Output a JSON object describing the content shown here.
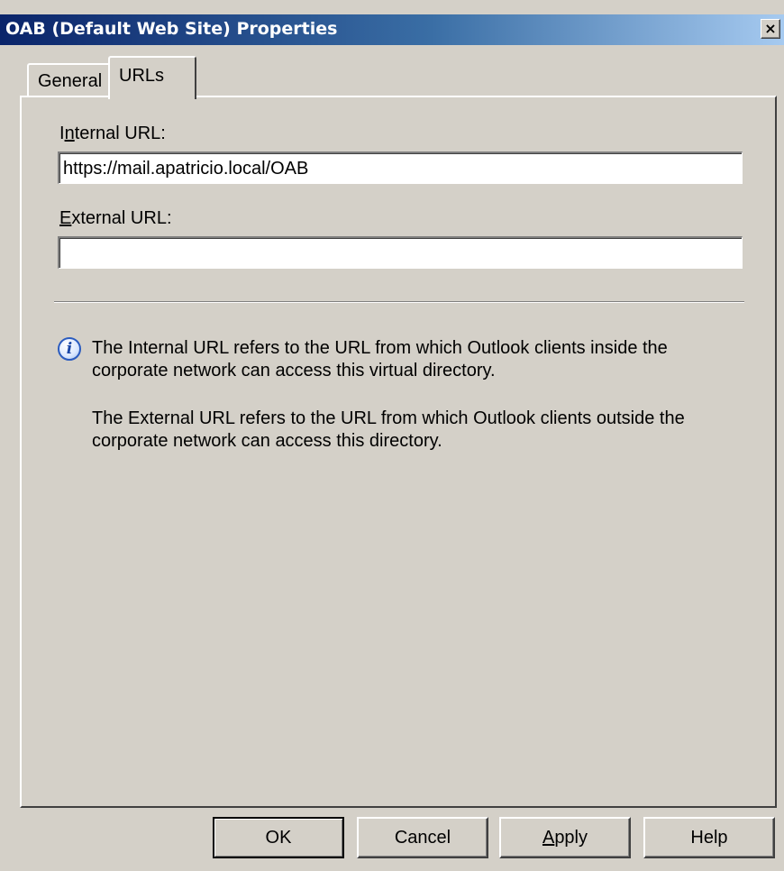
{
  "window": {
    "title": "OAB (Default Web Site) Properties",
    "close_glyph": "×",
    "close_icon": "close-icon",
    "title_gradient": [
      "#0a246a",
      "#a6caf0"
    ]
  },
  "tabs": [
    {
      "label": "General",
      "selected": false
    },
    {
      "label": "URLs",
      "selected": true
    }
  ],
  "form": {
    "internal_label_prefix": "I",
    "internal_label_mnemonic": "n",
    "internal_label_rest": "ternal URL:",
    "internal_value": "https://mail.apatricio.local/OAB",
    "external_label_mnemonic": "E",
    "external_label_rest": "xternal URL:",
    "external_value": ""
  },
  "info": {
    "icon": "info-icon",
    "icon_glyph": "i",
    "text_1": "The Internal URL refers to the URL from which Outlook clients inside the corporate network can access this virtual directory.",
    "text_2": "The External URL refers to the URL from which Outlook clients outside the corporate network can access this directory."
  },
  "buttons": {
    "ok": "OK",
    "cancel": "Cancel",
    "apply_mnemonic": "A",
    "apply_rest": "pply",
    "help": "Help"
  }
}
